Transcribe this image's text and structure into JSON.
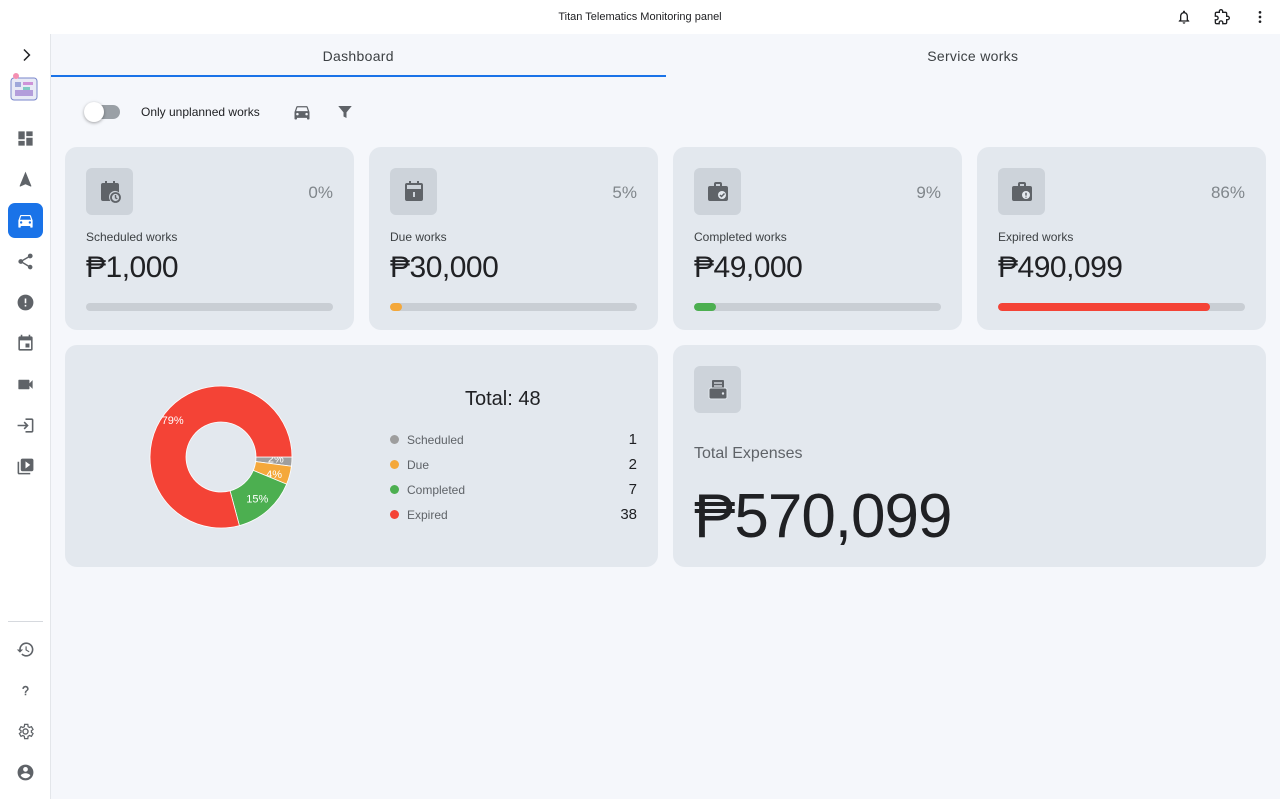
{
  "app": {
    "title": "Titan Telematics Monitoring panel"
  },
  "topbar": {
    "icons": [
      "bell-icon",
      "extension-icon",
      "more-vert-icon"
    ]
  },
  "sidebar": {
    "expand_icon": "chevron-right-icon",
    "logo_icon": "app-logo-icon",
    "items": [
      "dashboard-icon",
      "navigation-icon",
      "car-icon",
      "share-icon",
      "alert-icon",
      "calendar-icon",
      "videocam-icon",
      "login-icon",
      "video-library-icon"
    ],
    "active_item": "car-icon",
    "bottom_items": [
      "history-icon",
      "help-icon",
      "settings-icon",
      "account-icon"
    ]
  },
  "tabs": [
    {
      "label": "Dashboard",
      "active": true
    },
    {
      "label": "Service works",
      "active": false
    }
  ],
  "filters": {
    "toggle_label": "Only unplanned works",
    "toggle_on": false,
    "icons": [
      "car-icon",
      "filter-icon"
    ]
  },
  "stats": [
    {
      "label": "Scheduled works",
      "amount": "₱1,000",
      "percent": "0%",
      "progress": 0,
      "color": "#9e9e9e",
      "icon": "calendar-clock-icon"
    },
    {
      "label": "Due works",
      "amount": "₱30,000",
      "percent": "5%",
      "progress": 5,
      "color": "#f4a83b",
      "icon": "calendar-due-icon"
    },
    {
      "label": "Completed works",
      "amount": "₱49,000",
      "percent": "9%",
      "progress": 9,
      "color": "#4caf50",
      "icon": "briefcase-check-icon"
    },
    {
      "label": "Expired works",
      "amount": "₱490,099",
      "percent": "86%",
      "progress": 86,
      "color": "#f44336",
      "icon": "briefcase-alert-icon"
    }
  ],
  "breakdown": {
    "total_label": "Total: 48",
    "items": [
      {
        "name": "Scheduled",
        "value": "1",
        "color": "#9e9e9e"
      },
      {
        "name": "Due",
        "value": "2",
        "color": "#f4a83b"
      },
      {
        "name": "Completed",
        "value": "7",
        "color": "#4caf50"
      },
      {
        "name": "Expired",
        "value": "38",
        "color": "#f44336"
      }
    ]
  },
  "chart_data": {
    "type": "pie",
    "categories": [
      "Scheduled",
      "Due",
      "Completed",
      "Expired"
    ],
    "values": [
      1,
      2,
      7,
      38
    ],
    "data_labels": [
      "2%",
      "4%",
      "15%",
      "79%"
    ],
    "colors": [
      "#9e9e9e",
      "#f4a83b",
      "#4caf50",
      "#f44336"
    ],
    "title": "Total: 48"
  },
  "expenses": {
    "label": "Total Expenses",
    "amount": "₱570,099",
    "icon": "receipt-wallet-icon"
  }
}
